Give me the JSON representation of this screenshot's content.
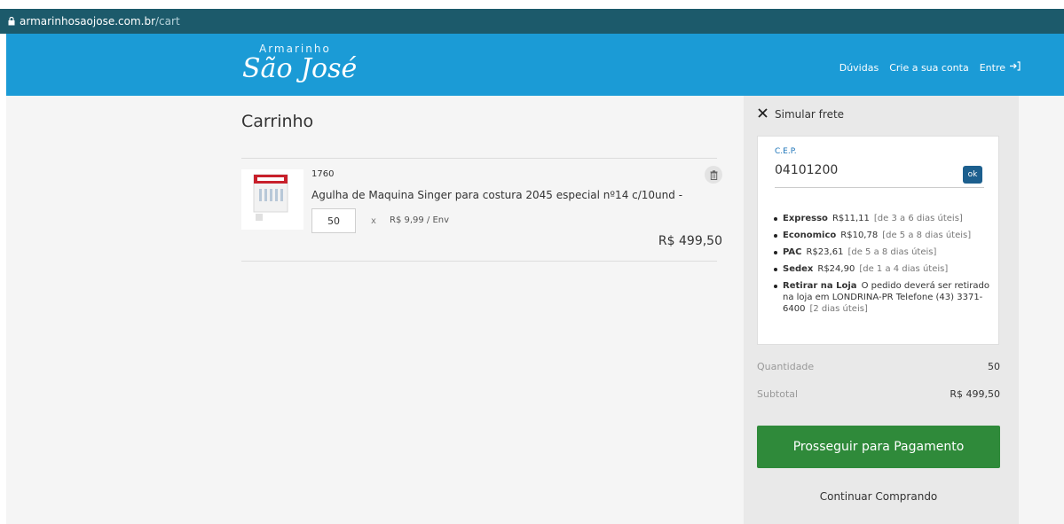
{
  "browser": {
    "url_host": "armarinhosaojose.com.br",
    "url_path": "/cart"
  },
  "header": {
    "logo_top": "Armarinho",
    "logo_main": "São José",
    "nav": [
      "Dúvidas",
      "Crie a sua conta",
      "Entre"
    ]
  },
  "cart": {
    "title": "Carrinho",
    "item": {
      "sku": "1760",
      "name": "Agulha de Maquina Singer para costura 2045 especial nº14 c/10und -",
      "quantity": "50",
      "times": "x",
      "unit_price": "R$ 9,99 / Env",
      "total": "R$ 499,50"
    }
  },
  "shipping": {
    "title": "Simular frete",
    "cep_label": "C.E.P.",
    "cep_value": "04101200",
    "ok_label": "ok",
    "options": [
      {
        "name": "Expresso",
        "price": "R$11,11",
        "days": "[de 3 a 6 dias úteis]"
      },
      {
        "name": "Economico",
        "price": "R$10,78",
        "days": "[de 5 a 8 dias úteis]"
      },
      {
        "name": "PAC",
        "price": "R$23,61",
        "days": "[de 5 a 8 dias úteis]"
      },
      {
        "name": "Sedex",
        "price": "R$24,90",
        "days": "[de 1 a 4 dias úteis]"
      },
      {
        "name": "Retirar na Loja",
        "price": "O pedido deverá ser retirado na loja em LONDRINA-PR Telefone (43) 3371-6400",
        "days": "[2 dias úteis]"
      }
    ]
  },
  "summary": {
    "quantity_label": "Quantidade",
    "quantity_value": "50",
    "subtotal_label": "Subtotal",
    "subtotal_value": "R$ 499,50",
    "pay_button": "Prosseguir para Pagamento",
    "continue_link": "Continuar Comprando"
  },
  "colors": {
    "url_bar": "#1c5a6b",
    "header": "#1b9bd6",
    "pay_button": "#2f8a3a",
    "ok_button": "#1c5f8e"
  }
}
